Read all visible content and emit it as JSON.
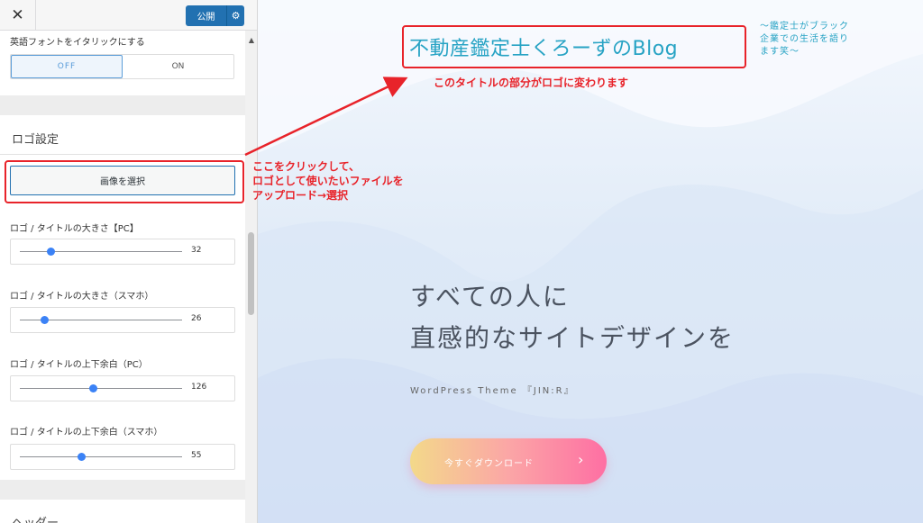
{
  "sidebar": {
    "close_label": "✕",
    "publish_label": "公開",
    "gear_glyph": "⚙",
    "italic_label": "英語フォントをイタリックにする",
    "toggle": {
      "off": "OFF",
      "on": "ON",
      "selected": "OFF"
    },
    "logo_section_title": "ロゴ設定",
    "select_image_label": "画像を選択",
    "sliders": [
      {
        "label": "ロゴ / タイトルの大きさ【PC】",
        "value": "32",
        "fraction": 0.19
      },
      {
        "label": "ロゴ / タイトルの大きさ（スマホ）",
        "value": "26",
        "fraction": 0.15
      },
      {
        "label": "ロゴ / タイトルの上下余白（PC）",
        "value": "126",
        "fraction": 0.45
      },
      {
        "label": "ロゴ / タイトルの上下余白（スマホ）",
        "value": "55",
        "fraction": 0.38
      }
    ],
    "header_section_title": "ヘッダー"
  },
  "preview": {
    "site_title": "不動産鑑定士くろーずのBlog",
    "tagline": "〜鑑定士がブラック企業での生活を語ります笑〜",
    "hero_line1": "すべての人に",
    "hero_line2": "直感的なサイトデザインを",
    "hero_sub": "WordPress Theme 『JIN:R』",
    "download_label": "今すぐダウンロード",
    "download_chevron": "›"
  },
  "annotations": {
    "title_note": "このタイトルの部分がロゴに変わります",
    "button_note_line1": "ここをクリックして、",
    "button_note_line2": "ロゴとして使いたいファイルを",
    "button_note_line3": "アップロード→選択"
  },
  "colors": {
    "accent_blue": "#2271b1",
    "annotation_red": "#e8232a",
    "site_title_color": "#27a3c4",
    "slider_thumb": "#3b82f6"
  }
}
